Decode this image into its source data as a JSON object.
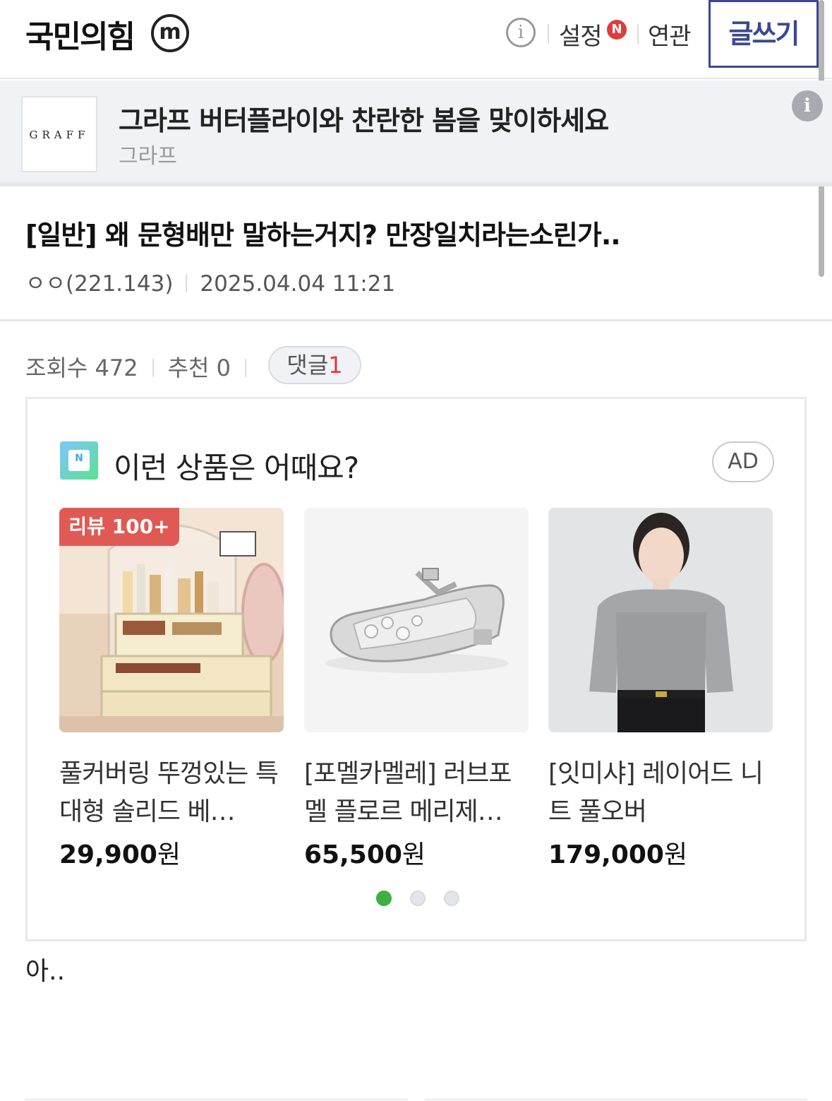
{
  "header": {
    "gallery_title": "국민의힘",
    "m_badge": "m",
    "info_icon": "i",
    "settings_label": "설정",
    "new_badge": "N",
    "related_label": "연관",
    "write_button": "글쓰기"
  },
  "top_ad": {
    "logo_text": "GRAFF",
    "title": "그라프 버터플라이와 찬란한 봄을 맞이하세요",
    "advertiser": "그라프",
    "info_icon": "i"
  },
  "post": {
    "title": "[일반] 왜 문형배만 말하는거지? 만장일치라는소린가..",
    "author": "ㅇㅇ(221.143)",
    "datetime": "2025.04.04 11:21",
    "views": "조회수 472",
    "recommend": "추천 0",
    "comment_label": "댓글",
    "comment_count": "1",
    "body": "아.."
  },
  "product_ad": {
    "title": "이런 상품은 어때요?",
    "ad_badge": "AD",
    "shop_icon_text": "N",
    "products": [
      {
        "badge": "리뷰 100+",
        "name": "풀커버링 뚜껑있는 특대형 솔리드 베…",
        "price": "29,900",
        "unit": "원",
        "image": "cosmetic-organizer"
      },
      {
        "badge": "",
        "name": "[포멜카멜레] 러브포멜 플로르 메리제…",
        "price": "65,500",
        "unit": "원",
        "image": "silver-flat-shoe"
      },
      {
        "badge": "",
        "name": "[잇미샤] 레이어드 니트 풀오버",
        "price": "179,000",
        "unit": "원",
        "image": "knit-pullover-model"
      }
    ],
    "pagination": {
      "total": 3,
      "active": 0,
      "active_color": "#3cb043"
    }
  },
  "colors": {
    "accent": "#3b4890",
    "red": "#e03b3b",
    "review_badge": "#e05a55"
  }
}
